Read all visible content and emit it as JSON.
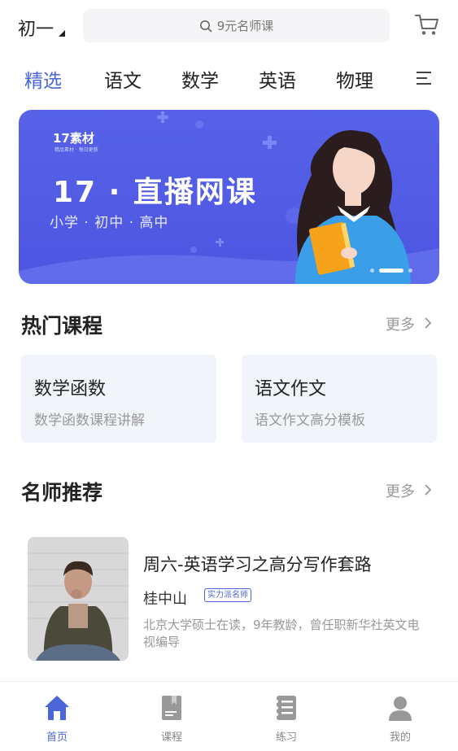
{
  "header": {
    "grade": "初一",
    "search_placeholder": "9元名师课"
  },
  "tabs": [
    {
      "label": "精选",
      "active": true
    },
    {
      "label": "语文",
      "active": false
    },
    {
      "label": "数学",
      "active": false
    },
    {
      "label": "英语",
      "active": false
    },
    {
      "label": "物理",
      "active": false
    }
  ],
  "banner": {
    "logo": "17素材",
    "logo_sub": "精品素材 · 每日更新",
    "title": "17 · 直播网课",
    "subtitle": "小学 · 初中 · 高中",
    "slide_count": 3,
    "active_slide": 1
  },
  "hot_courses": {
    "title": "热门课程",
    "more": "更多",
    "cards": [
      {
        "title": "数学函数",
        "desc": "数学函数课程讲解"
      },
      {
        "title": "语文作文",
        "desc": "语文作文高分模板"
      }
    ]
  },
  "teachers": {
    "title": "名师推荐",
    "more": "更多",
    "item": {
      "course": "周六-英语学习之高分写作套路",
      "name": "桂中山",
      "badge": "实力派名师",
      "desc": "北京大学硕士在读，9年教龄，曾任职新华社英文电视编导"
    }
  },
  "bottom_nav": [
    {
      "label": "首页",
      "icon": "home-icon",
      "active": true
    },
    {
      "label": "课程",
      "icon": "book-icon",
      "active": false
    },
    {
      "label": "练习",
      "icon": "exercise-icon",
      "active": false
    },
    {
      "label": "我的",
      "icon": "user-icon",
      "active": false
    }
  ],
  "colors": {
    "accent": "#4a66d8",
    "banner": "#5662e8",
    "card_bg": "#f1f4f9"
  }
}
